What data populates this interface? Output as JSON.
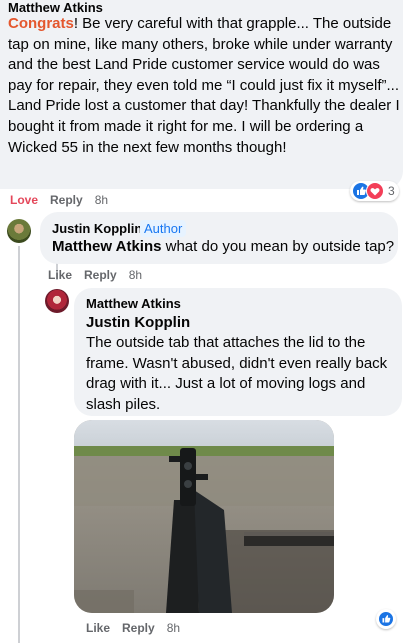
{
  "comment1": {
    "author": "Matthew Atkins",
    "highlight": "Congrats",
    "text": "! Be very careful with that grapple... The outside tap on mine, like many others, broke while under warranty and the best Land Pride customer service would do was pay for repair, they even told me “I could just fix it myself”... Land Pride lost a customer that day! Thankfully the dealer I bought it from made it right for me. I will be ordering a Wicked 55 in the next few months though!",
    "actions": {
      "reaction": "Love",
      "reply": "Reply",
      "time": "8h"
    },
    "reaction_count": "3",
    "reaction_icons": [
      "like-icon",
      "love-icon"
    ]
  },
  "comment2": {
    "author": "Justin Kopplin",
    "badge": "Author",
    "mention": "Matthew Atkins",
    "text": " what do you mean by outside tap?",
    "actions": {
      "reaction": "Like",
      "reply": "Reply",
      "time": "8h"
    }
  },
  "comment3": {
    "author": "Matthew Atkins",
    "mention": "Justin Kopplin",
    "text": "The outside tab that attaches the lid to the frame. Wasn't abused, didn't even really back drag with it... Just a lot of moving logs and slash piles.",
    "actions": {
      "reaction": "Like",
      "reply": "Reply",
      "time": "8h"
    },
    "reaction_icons": [
      "like-icon"
    ]
  },
  "colors": {
    "highlight": "#e4572e",
    "love": "#e4475a",
    "like_blue": "#1b74e4",
    "bubble": "#f0f2f5",
    "muted": "#65676b"
  }
}
